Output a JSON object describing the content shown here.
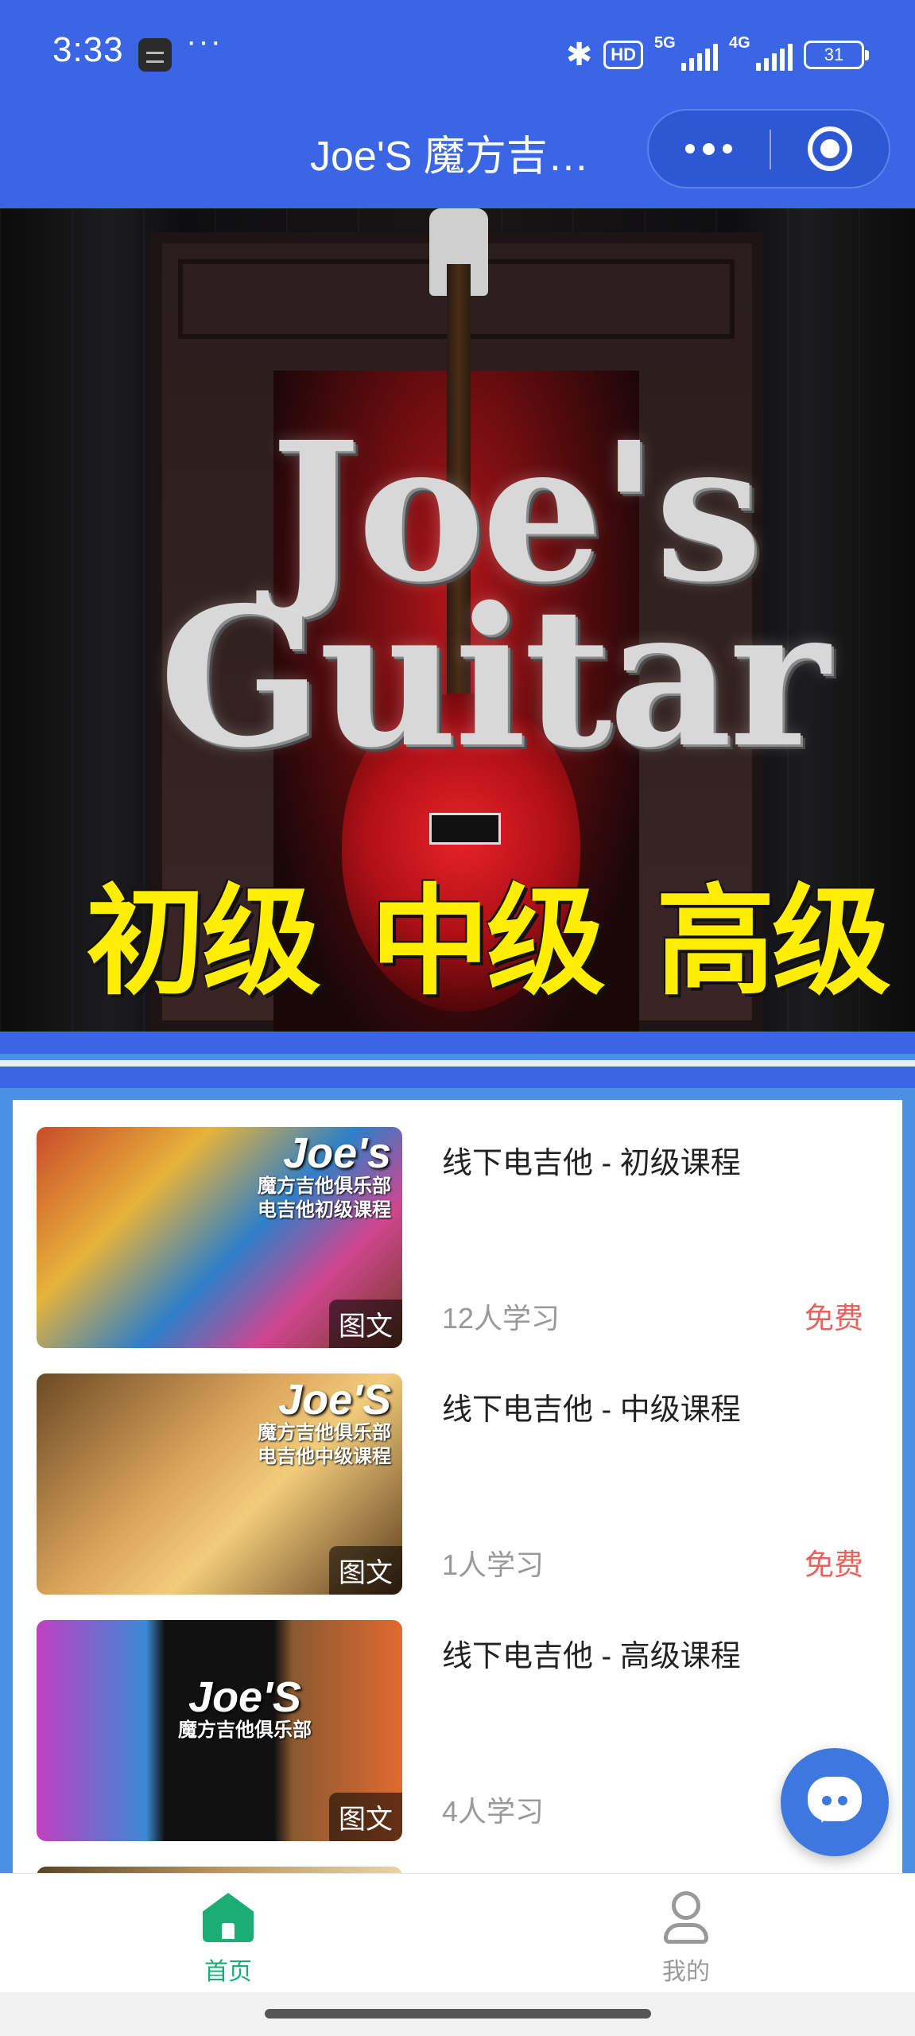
{
  "status": {
    "time": "3:33",
    "more": "···",
    "network_badge": "HD",
    "net1": "5G",
    "net2": "4G",
    "battery": "31"
  },
  "header": {
    "title": "Joe'S 魔方吉…"
  },
  "banner": {
    "logo_line1": "Joe's",
    "logo_line2": "Guitar",
    "levels": [
      "初级",
      "中级",
      "高级"
    ]
  },
  "courses": [
    {
      "title": "线下电吉他 - 初级课程",
      "learners": "12人学习",
      "price": "免费",
      "tag": "图文",
      "thumb_brand": "Joe's",
      "thumb_lines": [
        "魔方吉他俱乐部",
        "电吉他初级课程"
      ]
    },
    {
      "title": "线下电吉他 - 中级课程",
      "learners": "1人学习",
      "price": "免费",
      "tag": "图文",
      "thumb_brand": "Joe'S",
      "thumb_lines": [
        "魔方吉他俱乐部",
        "电吉他中级课程"
      ]
    },
    {
      "title": "线下电吉他 - 高级课程",
      "learners": "4人学习",
      "price": "",
      "tag": "图文",
      "thumb_brand": "Joe'S",
      "thumb_lines": [
        "魔方吉他俱乐部"
      ]
    }
  ],
  "tabbar": {
    "home": "首页",
    "mine": "我的"
  },
  "colors": {
    "header_bg": "#3a66e6",
    "active_tab": "#1aad75",
    "price": "#e9625e",
    "fab": "#3e78df"
  },
  "icons": {
    "home": "home-icon",
    "mine": "user-icon",
    "chat": "chat-bubble-icon",
    "close": "target-close-icon",
    "more": "more-dots-icon"
  }
}
